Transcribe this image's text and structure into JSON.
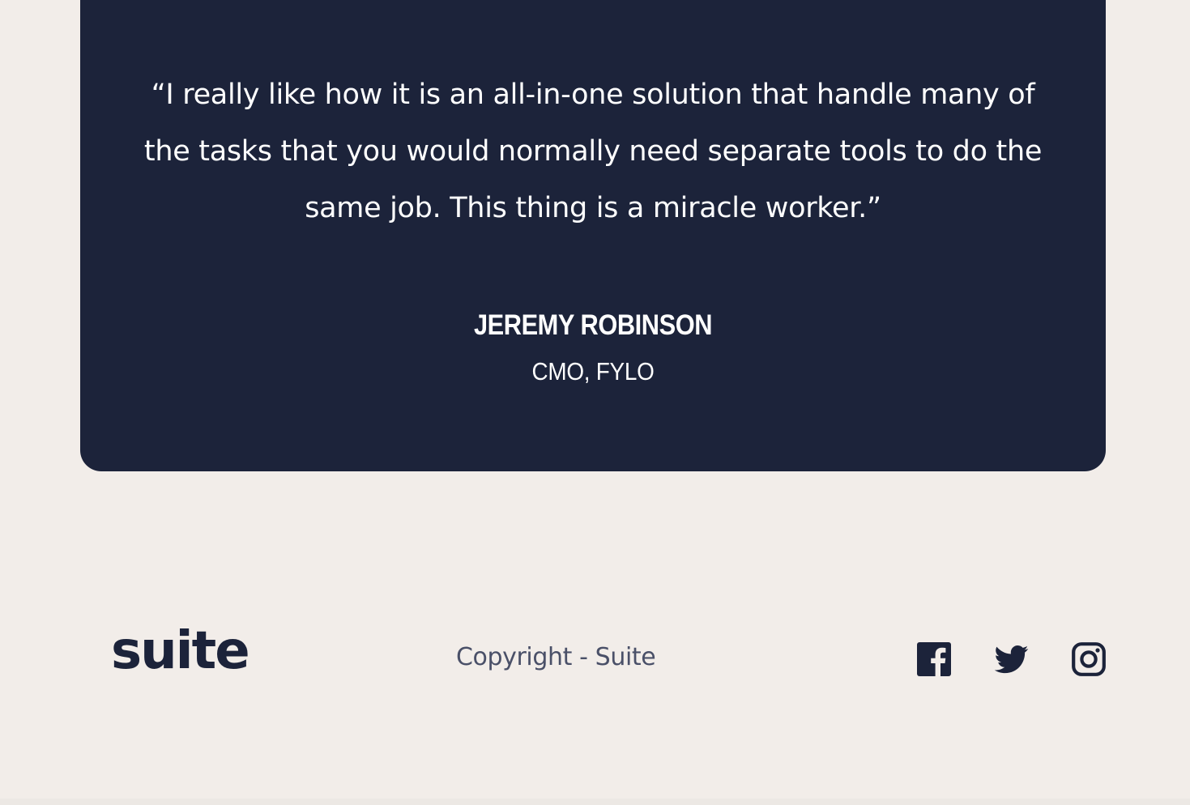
{
  "testimonial": {
    "quote": "“I really like how it is an all-in-one solution that handle many of the tasks that you would normally need separate tools to do the same job. This thing is a miracle worker.”",
    "author_name": "JEREMY ROBINSON",
    "author_role": "CMO, FYLO"
  },
  "footer": {
    "logo": "suite",
    "copyright": "Copyright - Suite",
    "social": [
      {
        "icon": "facebook-icon"
      },
      {
        "icon": "twitter-icon"
      },
      {
        "icon": "instagram-icon"
      }
    ]
  },
  "colors": {
    "background": "#f2ede9",
    "card": "#1c233a",
    "text_light": "#ffffff",
    "text_dark": "#1c233a",
    "text_muted": "#4a5068"
  }
}
